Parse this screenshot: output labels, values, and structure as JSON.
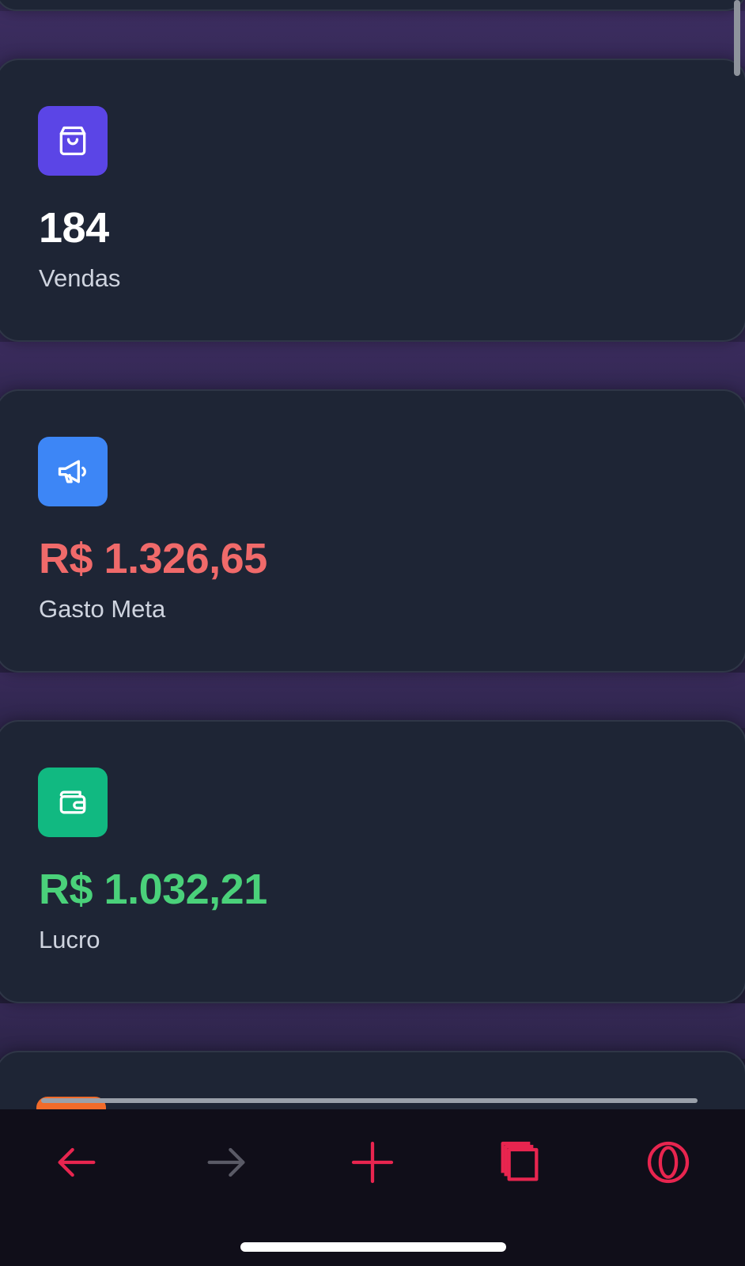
{
  "colors": {
    "background": "#1f1d33",
    "card": "#1e2535",
    "value_neutral": "#ffffff",
    "value_negative": "#f06a6a",
    "value_positive": "#4ad17a",
    "toolbar_accent": "#e8254f",
    "toolbar_disabled": "#5a5a66"
  },
  "cards": [
    {
      "icon": "shopping-bag-icon",
      "icon_bg": "#5b45e6",
      "value": "184",
      "label": "Vendas",
      "value_color": "#ffffff"
    },
    {
      "icon": "megaphone-icon",
      "icon_bg": "#3d86f6",
      "value": "R$ 1.326,65",
      "label": "Gasto Meta",
      "value_color": "#f06a6a"
    },
    {
      "icon": "wallet-icon",
      "icon_bg": "#11b981",
      "value": "R$ 1.032,21",
      "label": "Lucro",
      "value_color": "#4ad17a"
    }
  ],
  "toolbar": {
    "buttons": [
      {
        "name": "back",
        "icon": "arrow-left-icon"
      },
      {
        "name": "forward",
        "icon": "arrow-right-icon"
      },
      {
        "name": "new-tab",
        "icon": "plus-icon"
      },
      {
        "name": "tabs",
        "icon": "tabs-icon"
      },
      {
        "name": "opera-menu",
        "icon": "opera-logo-icon"
      }
    ]
  }
}
